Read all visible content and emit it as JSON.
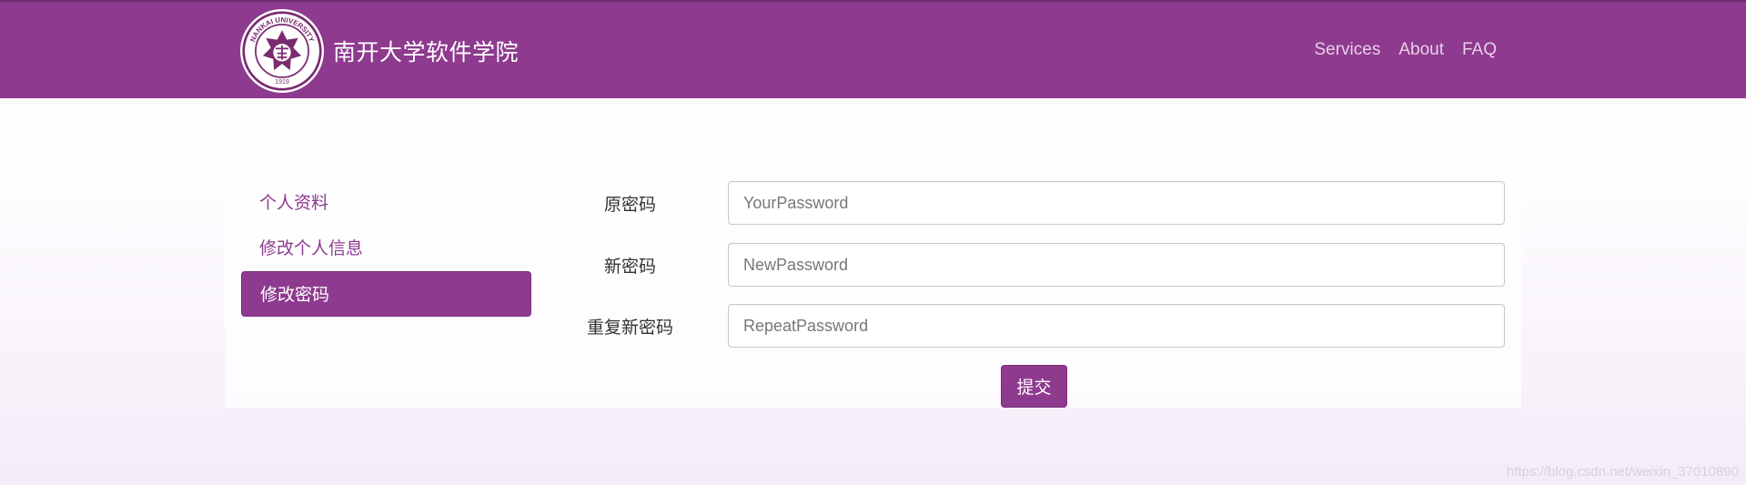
{
  "header": {
    "title": "南开大学软件学院",
    "logo_icon": "nankai-university-seal-icon",
    "nav": [
      "Services",
      "About",
      "FAQ"
    ],
    "accent_color": "#8e3a8e"
  },
  "sidebar": {
    "items": [
      {
        "label": "个人资料",
        "active": false
      },
      {
        "label": "修改个人信息",
        "active": false
      },
      {
        "label": "修改密码",
        "active": true
      }
    ]
  },
  "form": {
    "old_password": {
      "label": "原密码",
      "placeholder": "YourPassword"
    },
    "new_password": {
      "label": "新密码",
      "placeholder": "NewPassword"
    },
    "repeat_password": {
      "label": "重复新密码",
      "placeholder": "RepeatPassword"
    },
    "submit_label": "提交"
  },
  "watermark": "https://blog.csdn.net/weixin_37010890"
}
